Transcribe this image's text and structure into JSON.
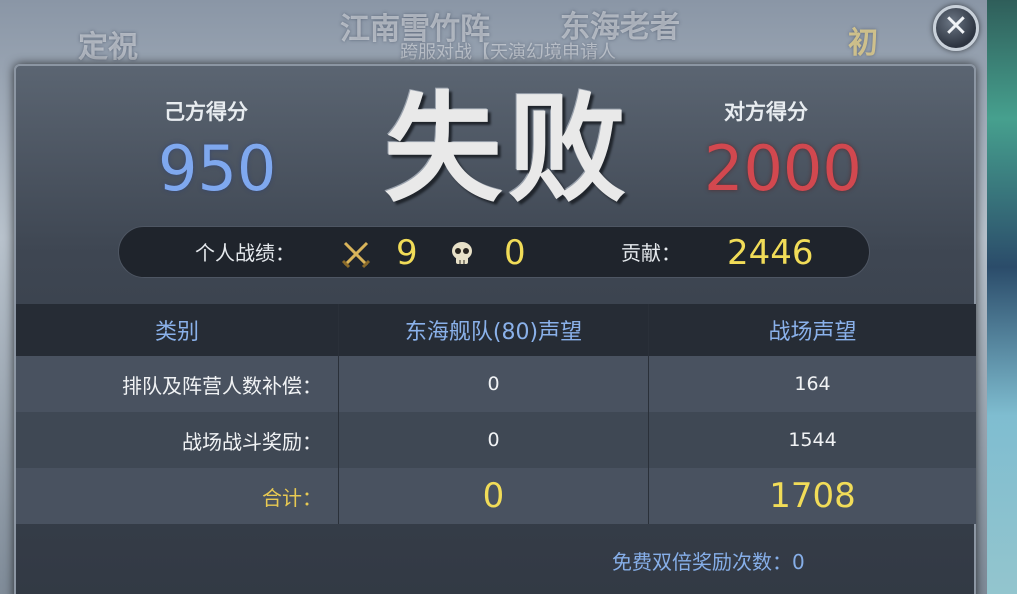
{
  "background": {
    "top_left_text": "定祝",
    "title_1": "江南雪竹阵",
    "title_2": "东海老者",
    "subtitle": "跨服对战【天演幻境申请人",
    "top_right_text": "初"
  },
  "result": {
    "my_score_label": "己方得分",
    "my_score": "950",
    "enemy_score_label": "对方得分",
    "enemy_score": "2000",
    "outcome": "失败"
  },
  "personal_stats": {
    "label": "个人战绩：",
    "kills": "9",
    "deaths": "0",
    "contribution_label": "贡献：",
    "contribution": "2446"
  },
  "rewards_table": {
    "headers": [
      "类别",
      "东海舰队(80)声望",
      "战场声望"
    ],
    "rows": [
      {
        "category": "排队及阵营人数补偿：",
        "fleet_rep": "0",
        "battlefield_rep": "164"
      },
      {
        "category": "战场战斗奖励：",
        "fleet_rep": "0",
        "battlefield_rep": "1544"
      }
    ],
    "total": {
      "category": "合计：",
      "fleet_rep": "0",
      "battlefield_rep": "1708"
    }
  },
  "footer_note": "免费双倍奖励次数：0",
  "icons": {
    "close": "close-icon",
    "kills": "crossed-swords-icon",
    "deaths": "skull-icon"
  },
  "colors": {
    "my_score": "#7fa8ef",
    "enemy_score": "#d2484f",
    "highlight": "#f1dc58",
    "header_text": "#8ab1ea"
  }
}
